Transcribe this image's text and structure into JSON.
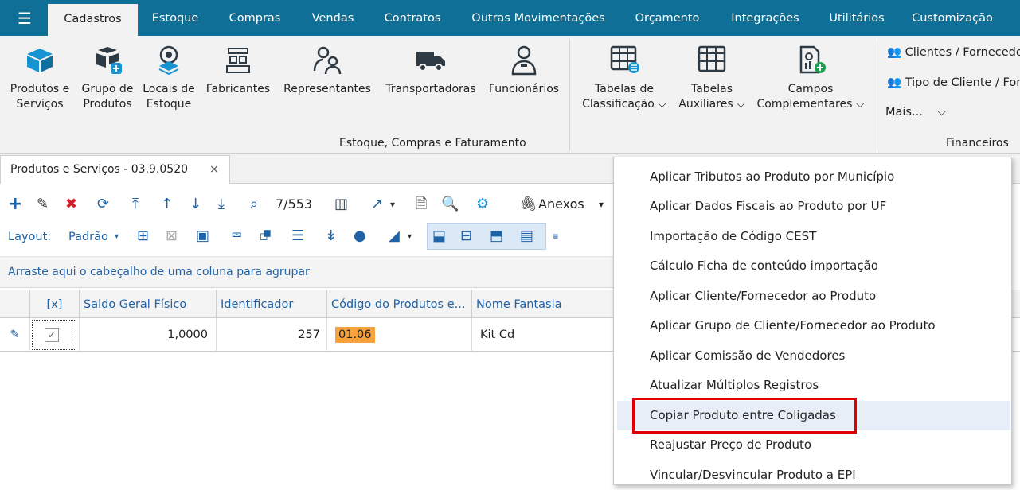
{
  "topnav": {
    "tabs": [
      "Cadastros",
      "Estoque",
      "Compras",
      "Vendas",
      "Contratos",
      "Outras Movimentações",
      "Orçamento",
      "Integrações",
      "Utilitários",
      "Customização"
    ],
    "active": "Cadastros"
  },
  "ribbon": {
    "buttons": [
      {
        "l1": "Produtos e",
        "l2": "Serviços",
        "icon": "box-icon"
      },
      {
        "l1": "Grupo de",
        "l2": "Produtos",
        "icon": "boxes-group-icon"
      },
      {
        "l1": "Locais de",
        "l2": "Estoque",
        "icon": "location-pin-icon"
      },
      {
        "l1": "Fabricantes",
        "l2": "",
        "icon": "factory-icon"
      },
      {
        "l1": "Representantes",
        "l2": "",
        "icon": "representatives-icon"
      },
      {
        "l1": "Transportadoras",
        "l2": "",
        "icon": "truck-icon"
      },
      {
        "l1": "Funcionários",
        "l2": "",
        "icon": "employee-icon"
      },
      {
        "l1": "Tabelas de",
        "l2": "Classificação",
        "icon": "classification-table-icon",
        "dropdown": true
      },
      {
        "l1": "Tabelas",
        "l2": "Auxiliares",
        "icon": "auxiliary-table-icon",
        "dropdown": true
      },
      {
        "l1": "Campos",
        "l2": "Complementares",
        "icon": "complementary-fields-icon",
        "dropdown": true
      }
    ],
    "group_label": "Estoque, Compras e Faturamento",
    "financeiros": {
      "item1": "Clientes / Fornecedores",
      "item2": "Tipo de Cliente / Fornecedor",
      "mais": "Mais...",
      "group_label": "Financeiros"
    }
  },
  "document_tab": {
    "title": "Produtos e Serviços - 03.9.0520",
    "close": "×"
  },
  "toolbar": {
    "record_counter": "7/553",
    "attachments_label": "Anexos",
    "layout_label": "Layout:",
    "layout_value": "Padrão"
  },
  "group_hint": "Arraste aqui o cabeçalho de uma coluna para agrupar",
  "grid": {
    "headers": [
      "[x]",
      "Saldo Geral Físico",
      "Identificador",
      "Código do Produtos e...",
      "Nome Fantasia"
    ],
    "row": {
      "saldo": "1,0000",
      "identificador": "257",
      "codigo": "01.06",
      "nome": "Kit Cd"
    }
  },
  "context_menu": {
    "items": [
      "Aplicar Tributos ao Produto por Município",
      "Aplicar Dados Fiscais ao Produto por UF",
      "Importação de Código CEST",
      "Cálculo Ficha de conteúdo importação",
      "Aplicar Cliente/Fornecedor ao Produto",
      "Aplicar Grupo de Cliente/Fornecedor ao Produto",
      "Aplicar Comissão de Vendedores",
      "Atualizar Múltiplos Registros",
      "Copiar Produto entre Coligadas",
      "Reajustar Preço de Produto",
      "Vincular/Desvincular Produto a EPI"
    ],
    "highlighted": "Copiar Produto entre Coligadas"
  },
  "colors": {
    "topbar": "#0f6f96",
    "link": "#1e62a8",
    "highlight_box": "#e00000",
    "code_cell": "#f7a23c",
    "icon_blue": "#1793d1",
    "icon_dark": "#2e3a44"
  }
}
